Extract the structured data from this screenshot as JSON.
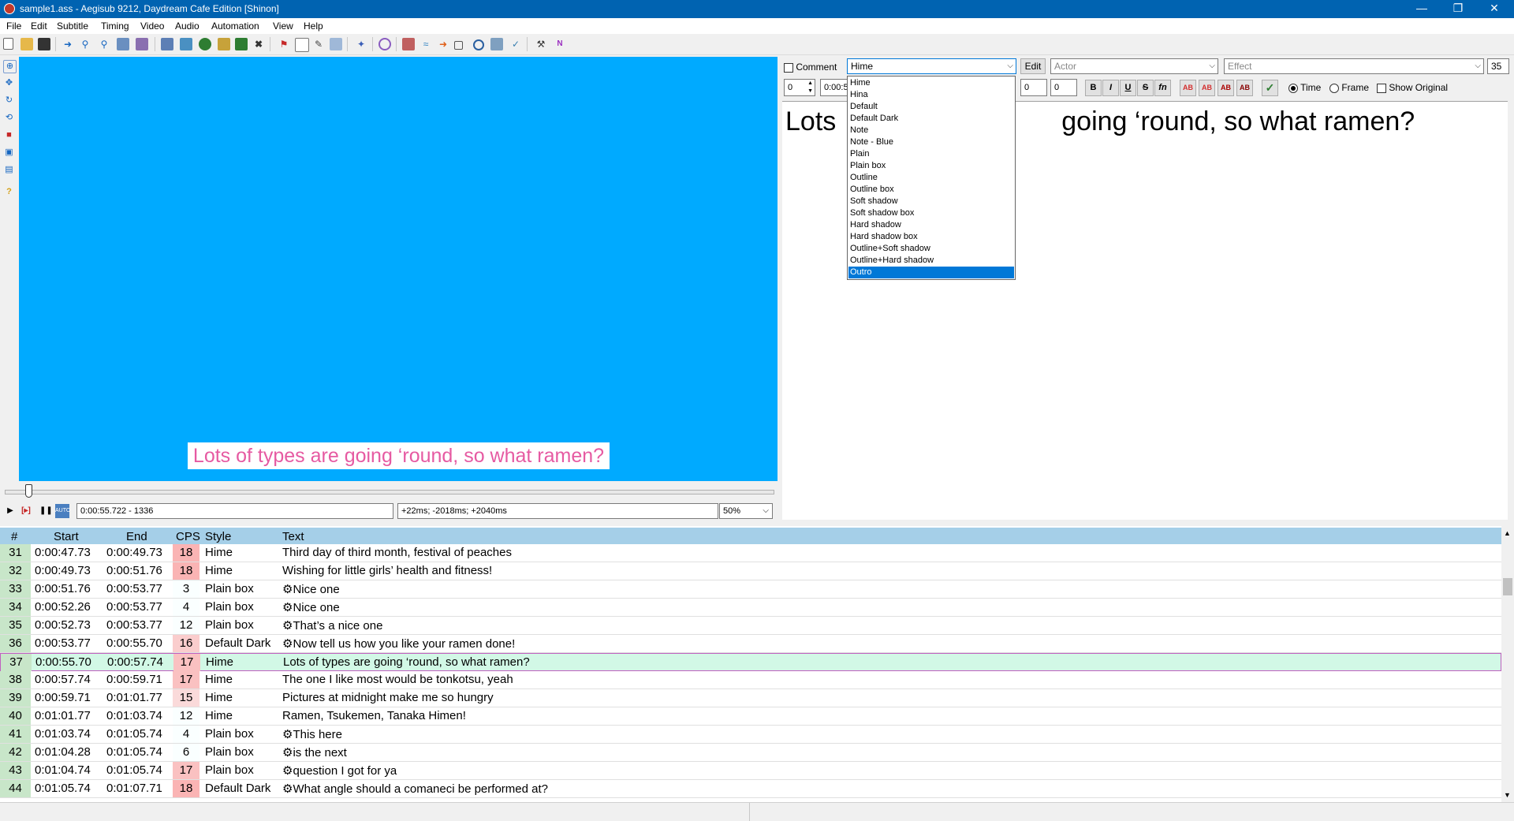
{
  "window": {
    "title": "sample1.ass - Aegisub 9212, Daydream Cafe Edition [Shinon]",
    "minimize": "—",
    "restore": "❐",
    "close": "✕"
  },
  "menu": [
    "File",
    "Edit",
    "Subtitle",
    "Timing",
    "Video",
    "Audio",
    "Automation",
    "View",
    "Help"
  ],
  "toolbar_icons": [
    "new-file-icon",
    "open-file-icon",
    "save-file-icon",
    "jump-icon",
    "zoom-in-icon",
    "zoom-out-icon",
    "zoom-video-icon",
    "snap-icon",
    "style-manager-icon",
    "attachments-icon",
    "resample-icon",
    "translate-icon",
    "spell-icon",
    "fonts-collector-icon",
    "properties-icon",
    "shift-times-icon",
    "timing-post-icon",
    "kanji-timer-icon",
    "auto-save-icon",
    "automation-icon",
    "options-icon",
    "tags-icon",
    "tools-icon",
    "macro-icon",
    "script-icon",
    "settings-icon",
    "hotkeys-icon",
    "info-icon"
  ],
  "video": {
    "subtitle": "Lots of types are going ‘round, so what ramen?",
    "time_frame": "0:00:55.722 - 1336",
    "offset": "+22ms; -2018ms; +2040ms",
    "zoom": "50%",
    "seek_position": 0.03
  },
  "edit": {
    "comment_label": "Comment",
    "style_value": "Hime",
    "edit_button": "Edit",
    "actor_placeholder": "Actor",
    "effect_placeholder": "Effect",
    "char_count": "35",
    "layer": "0",
    "start_time": "0:00:5",
    "margin_l": "0",
    "margin_r": "0",
    "fmt_buttons": [
      "B",
      "I",
      "U",
      "S",
      "fn",
      "AB",
      "AB",
      "AB",
      "AB",
      "✓"
    ],
    "time_label": "Time",
    "frame_label": "Frame",
    "show_original_label": "Show Original",
    "editor_text_left": "Lots",
    "editor_text_right": "going ‘round, so what ramen?"
  },
  "style_options": [
    "Hime",
    "Hina",
    "Default",
    "Default Dark",
    "Note",
    "Note - Blue",
    "Plain",
    "Plain box",
    "Outline",
    "Outline box",
    "Soft shadow",
    "Soft shadow box",
    "Hard shadow",
    "Hard shadow box",
    "Outline+Soft shadow",
    "Outline+Hard shadow",
    "Outro"
  ],
  "selected_style_option": "Outro",
  "grid": {
    "headers": [
      "#",
      "Start",
      "End",
      "CPS",
      "Style",
      "Text"
    ],
    "rows": [
      [
        "31",
        "0:00:47.73",
        "0:00:49.73",
        "18",
        "Hime",
        "Third day of third month, festival of peaches"
      ],
      [
        "32",
        "0:00:49.73",
        "0:00:51.76",
        "18",
        "Hime",
        "Wishing for little girls’ health and fitness!"
      ],
      [
        "33",
        "0:00:51.76",
        "0:00:53.77",
        "3",
        "Plain box",
        "Nice one"
      ],
      [
        "34",
        "0:00:52.26",
        "0:00:53.77",
        "4",
        "Plain box",
        "Nice one"
      ],
      [
        "35",
        "0:00:52.73",
        "0:00:53.77",
        "12",
        "Plain box",
        "That’s a nice one"
      ],
      [
        "36",
        "0:00:53.77",
        "0:00:55.70",
        "16",
        "Default Dark",
        "Now tell us how you like your ramen done!"
      ],
      [
        "37",
        "0:00:55.70",
        "0:00:57.74",
        "17",
        "Hime",
        "Lots of types are going ‘round, so what ramen?"
      ],
      [
        "38",
        "0:00:57.74",
        "0:00:59.71",
        "17",
        "Hime",
        "The one I like most would be tonkotsu, yeah"
      ],
      [
        "39",
        "0:00:59.71",
        "0:01:01.77",
        "15",
        "Hime",
        "Pictures at midnight make me so hungry"
      ],
      [
        "40",
        "0:01:01.77",
        "0:01:03.74",
        "12",
        "Hime",
        "Ramen, Tsukemen, Tanaka Himen!"
      ],
      [
        "41",
        "0:01:03.74",
        "0:01:05.74",
        "4",
        "Plain box",
        "This here"
      ],
      [
        "42",
        "0:01:04.28",
        "0:01:05.74",
        "6",
        "Plain box",
        "is the next"
      ],
      [
        "43",
        "0:01:04.74",
        "0:01:05.74",
        "17",
        "Plain box",
        "question I got for ya"
      ],
      [
        "44",
        "0:01:05.74",
        "0:01:07.71",
        "18",
        "Default Dark",
        "What angle should a comaneci be performed at?"
      ]
    ],
    "active_row": 6,
    "tag_marker": "⚙"
  },
  "colors": {
    "titlebar": "#0063b1",
    "video_bg": "#00aaff",
    "sub_text": "#e65aa2",
    "header_bg": "#a5cfe8",
    "active_row": "#d2f8e6",
    "selected_option": "#0078d7"
  }
}
